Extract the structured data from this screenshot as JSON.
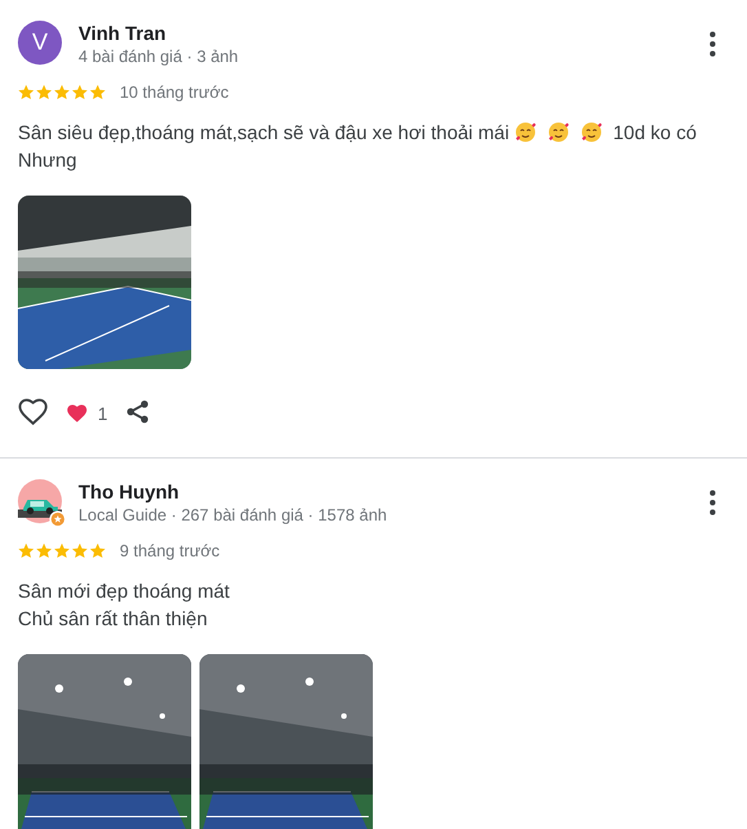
{
  "reviews": [
    {
      "author": {
        "name": "Vinh Tran",
        "avatar": {
          "kind": "letter",
          "initial": "V"
        },
        "stats": "4 bài đánh giá · 3 ảnh"
      },
      "stars": 5,
      "time": "10 tháng trước",
      "body": [
        {
          "kind": "text",
          "text": "Sân siêu đẹp,thoáng mát,sạch sẽ và đậu xe hơi thoải mái"
        },
        {
          "kind": "emoji"
        },
        {
          "kind": "emoji"
        },
        {
          "kind": "emoji"
        },
        {
          "kind": "text",
          "text": "10d ko có Nhưng"
        }
      ],
      "photos": [
        {
          "kind": "outdoor"
        }
      ],
      "actions": {
        "reaction_count": "1"
      }
    },
    {
      "author": {
        "name": "Tho Huynh",
        "avatar": {
          "kind": "car"
        },
        "local_guide": true,
        "stats": "Local Guide · 267 bài đánh giá · 1578 ảnh"
      },
      "stars": 5,
      "time": "9 tháng trước",
      "body": [
        {
          "kind": "text",
          "text": "Sân mới đẹp thoáng mát"
        },
        {
          "kind": "break"
        },
        {
          "kind": "text",
          "text": "Chủ sân rất thân thiện"
        }
      ],
      "photos": [
        {
          "kind": "indoor"
        },
        {
          "kind": "indoor"
        }
      ]
    }
  ]
}
